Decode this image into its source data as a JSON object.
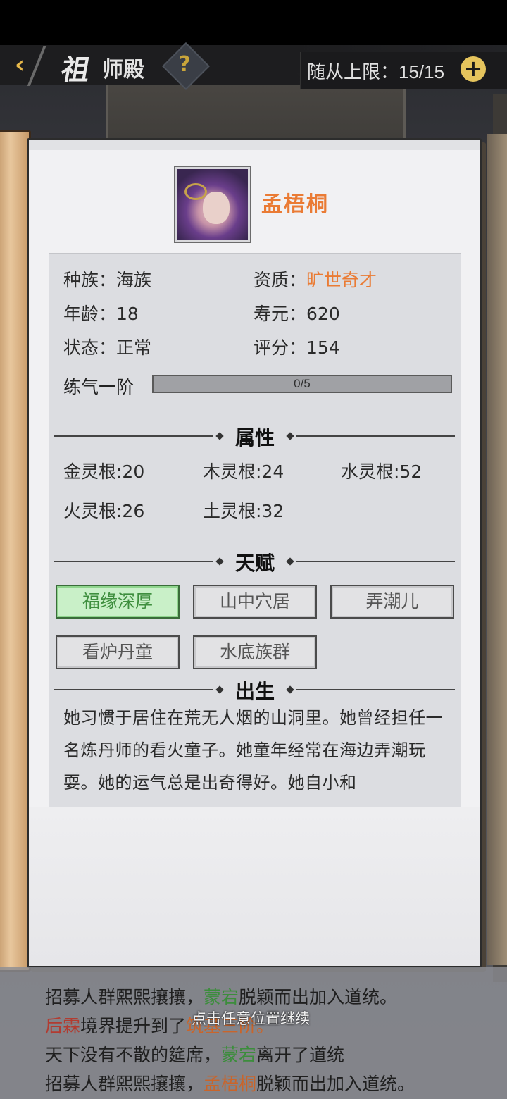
{
  "header": {
    "title_big": "祖",
    "title_small": "师殿",
    "help_label": "?",
    "follower_label": "随从上限：15/15",
    "add_label": "+"
  },
  "character": {
    "name": "孟梧桐",
    "avatar_icon": "character-portrait",
    "race_label": "种族：",
    "race_value": "海族",
    "aptitude_label": "资质：",
    "aptitude_value": "旷世奇才",
    "age_label": "年龄：",
    "age_value": "18",
    "lifespan_label": "寿元：",
    "lifespan_value": "620",
    "status_label": "状态：",
    "status_value": "正常",
    "score_label": "评分：",
    "score_value": "154",
    "realm_label": "练气一阶",
    "progress_text": "0/5",
    "progress_fraction": 0
  },
  "attributes": {
    "title": "属性",
    "items": [
      "金灵根:20",
      "木灵根:24",
      "水灵根:52",
      "火灵根:26",
      "土灵根:32"
    ]
  },
  "talents": {
    "title": "天赋",
    "items": [
      "福缘深厚",
      "山中穴居",
      "弄潮儿",
      "看炉丹童",
      "水底族群"
    ],
    "active_index": 0
  },
  "birth": {
    "title": "出生",
    "text": "她习惯于居住在荒无人烟的山洞里。她曾经担任一名炼丹师的看火童子。她童年经常在海边弄潮玩耍。她的运气总是出奇得好。她自小和"
  },
  "log": {
    "line1_a": "招募人群熙熙攘攘，",
    "line1_b": "蒙宕",
    "line1_c": "脱颖而出加入道统。",
    "line2_a": "后霖",
    "line2_b": "境界提升到了",
    "line2_c": "筑基三阶。",
    "line3_a": "天下没有不散的筵席，",
    "line3_b": "蒙宕",
    "line3_c": "离开了道统",
    "line4_a": "招募人群熙熙攘攘，",
    "line4_b": "孟梧桐",
    "line4_c": "脱颖而出加入道统。",
    "continue_hint": "点击任意位置继续"
  },
  "colors": {
    "accent_orange": "#ea7b34",
    "active_green": "#3e8e3e",
    "gold": "#e5c45d"
  }
}
